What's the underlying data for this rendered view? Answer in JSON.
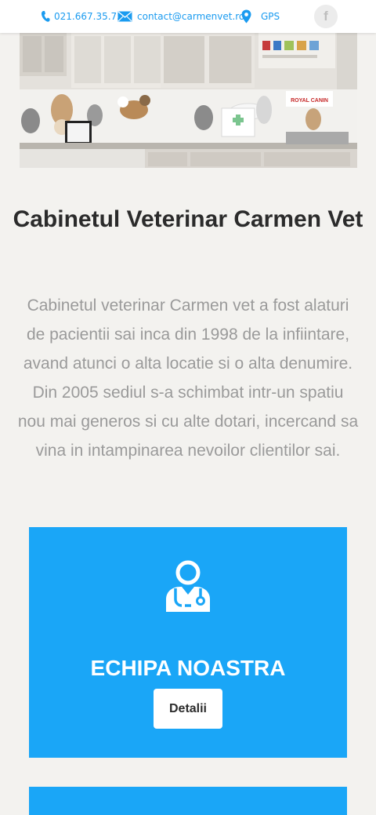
{
  "header": {
    "phone": "021.667.35.75",
    "email": "contact@carmenvet.ro",
    "gps": "GPS",
    "facebook_glyph": "f",
    "icons": [
      "phone-icon",
      "mail-icon",
      "location-pin-icon",
      "facebook-icon"
    ],
    "accent_color": "#1a9bf0"
  },
  "hero": {
    "image": "clinic-interior-photo",
    "sign_text": "ROYAL CANIN"
  },
  "main": {
    "title": "Cabinetul Veterinar Carmen Vet",
    "description": "Cabinetul veterinar Carmen vet a fost alaturi de pacientii sai inca din 1998 de la infiintare, avand atunci o alta locatie si o alta denumire. Din 2005 sediul s-a schimbat intr-un spatiu nou mai generos si cu alte dotari, incercand sa vina in intampinarea nevoilor clientilor sai."
  },
  "cards": [
    {
      "icon": "doctor-icon",
      "title": "ECHIPA NOASTRA",
      "button_label": "Detalii",
      "color": "#1aa6f7"
    },
    {
      "color": "#1aa6f7"
    }
  ]
}
